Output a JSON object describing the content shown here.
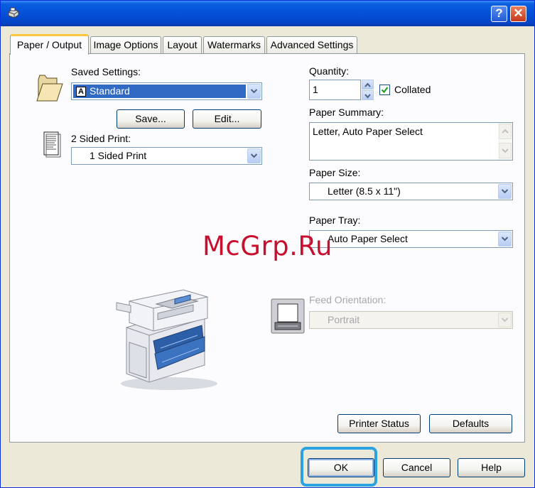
{
  "window": {
    "help_button": "?",
    "close_button": "✕",
    "icon": "printer-icon"
  },
  "tabs": [
    {
      "label": "Paper / Output",
      "active": true
    },
    {
      "label": "Image Options"
    },
    {
      "label": "Layout"
    },
    {
      "label": "Watermarks"
    },
    {
      "label": "Advanced Settings"
    }
  ],
  "saved_settings": {
    "label": "Saved Settings:",
    "value": "Standard",
    "badge": "A",
    "save_label": "Save...",
    "edit_label": "Edit..."
  },
  "two_sided": {
    "label": "2 Sided Print:",
    "value": "1 Sided Print"
  },
  "quantity": {
    "label": "Quantity:",
    "value": "1",
    "collated_label": "Collated",
    "collated": true
  },
  "paper_summary": {
    "label": "Paper Summary:",
    "value": "Letter, Auto Paper Select"
  },
  "paper_size": {
    "label": "Paper Size:",
    "value": "Letter (8.5 x 11\")"
  },
  "paper_tray": {
    "label": "Paper Tray:",
    "value": "Auto Paper Select"
  },
  "feed_orientation": {
    "label": "Feed Orientation:",
    "value": "Portrait",
    "disabled": true
  },
  "panel_buttons": {
    "printer_status": "Printer Status",
    "defaults": "Defaults"
  },
  "footer": {
    "ok": "OK",
    "cancel": "Cancel",
    "help": "Help"
  },
  "watermark_text": "McGrp.Ru",
  "colors": {
    "title_bar": "#0550d8",
    "selection": "#316ac5",
    "ok_highlight": "#2aa3e0",
    "watermark": "#c8102e",
    "dialog_face": "#ece9d8"
  }
}
